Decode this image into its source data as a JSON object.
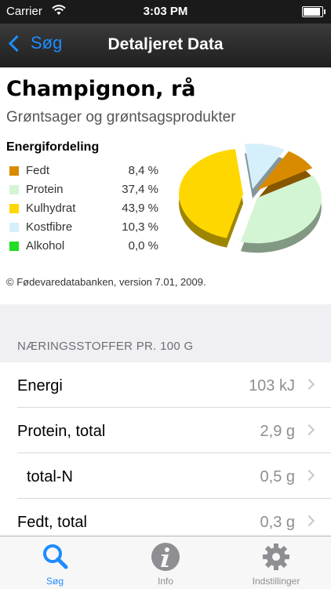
{
  "status_bar": {
    "carrier": "Carrier",
    "time": "3:03 PM"
  },
  "nav": {
    "back_label": "Søg",
    "title": "Detaljeret Data"
  },
  "food": {
    "name": "Champignon, rå",
    "group": "Grøntsager og grøntsagsprodukter"
  },
  "distribution": {
    "title": "Energifordeling",
    "items": [
      {
        "name": "Fedt",
        "value": "8,4 %",
        "color": "#d98b00"
      },
      {
        "name": "Protein",
        "value": "37,4 %",
        "color": "#d4f5d4"
      },
      {
        "name": "Kulhydrat",
        "value": "43,9 %",
        "color": "#ffd700"
      },
      {
        "name": "Kostfibre",
        "value": "10,3 %",
        "color": "#d6f0fb"
      },
      {
        "name": "Alkohol",
        "value": "0,0 %",
        "color": "#22dd22"
      }
    ]
  },
  "chart_data": {
    "type": "pie",
    "categories": [
      "Fedt",
      "Protein",
      "Kulhydrat",
      "Kostfibre",
      "Alkohol"
    ],
    "values": [
      8.4,
      37.4,
      43.9,
      10.3,
      0.0
    ],
    "colors": [
      "#d98b00",
      "#d4f5d4",
      "#ffd700",
      "#d6f0fb",
      "#22dd22"
    ]
  },
  "copyright": "© Fødevaredatabanken, version 7.01, 2009.",
  "nutrients": {
    "section_title": "NÆRINGSSTOFFER PR. 100 G",
    "items": [
      {
        "label": "Energi",
        "value": "103 kJ",
        "indent": false
      },
      {
        "label": "Protein, total",
        "value": "2,9 g",
        "indent": false
      },
      {
        "label": "total-N",
        "value": "0,5 g",
        "indent": true
      },
      {
        "label": "Fedt, total",
        "value": "0,3 g",
        "indent": false
      }
    ]
  },
  "tabs": [
    {
      "label": "Søg",
      "icon": "search-icon",
      "active": true
    },
    {
      "label": "Info",
      "icon": "info-icon",
      "active": false
    },
    {
      "label": "Indstillinger",
      "icon": "gear-icon",
      "active": false
    }
  ]
}
